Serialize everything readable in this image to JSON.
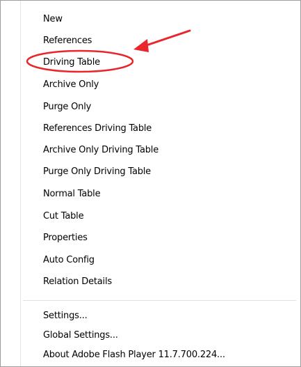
{
  "menu": {
    "items": [
      {
        "label": "New"
      },
      {
        "label": "References"
      },
      {
        "label": "Driving Table"
      },
      {
        "label": "Archive Only"
      },
      {
        "label": "Purge Only"
      },
      {
        "label": "References  Driving Table"
      },
      {
        "label": "Archive Only  Driving Table"
      },
      {
        "label": "Purge Only  Driving Table"
      },
      {
        "label": "Normal Table"
      },
      {
        "label": "Cut Table"
      },
      {
        "label": "Properties"
      },
      {
        "label": "Auto Config"
      },
      {
        "label": "Relation Details"
      }
    ],
    "footer_items": [
      {
        "label": "Settings..."
      },
      {
        "label": "Global Settings..."
      },
      {
        "label": "About Adobe Flash Player 11.7.700.224..."
      }
    ]
  },
  "annotation": {
    "highlight_color": "#e8262c",
    "highlighted_item": "Driving Table"
  }
}
